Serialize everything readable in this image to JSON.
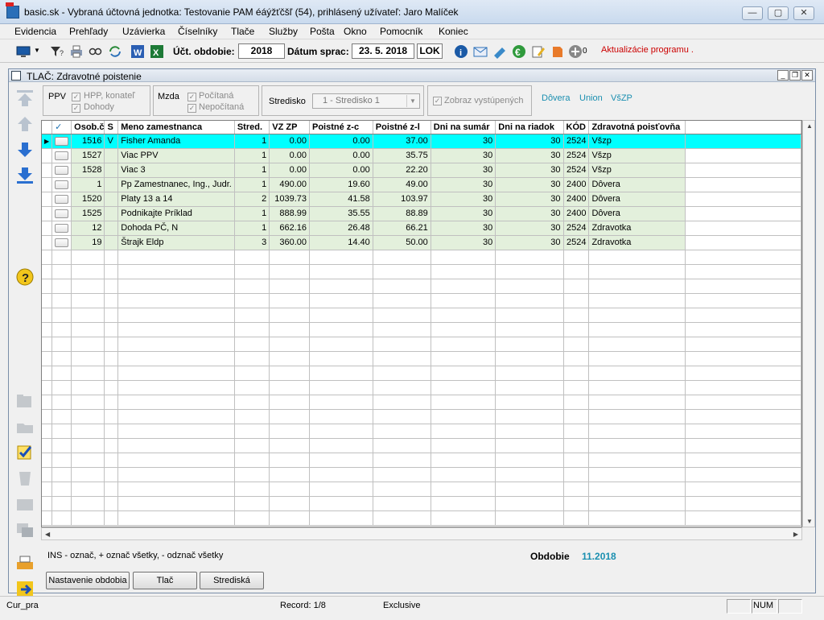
{
  "window": {
    "title": "basic.sk - Vybraná účtovná jednotka: Testovanie PAM éáýžťčšľ (54),  prihlásený užívateľ: Jaro Malíček",
    "min": "—",
    "max": "▢",
    "close": "✕"
  },
  "menu": [
    "Evidencia",
    "Prehľady",
    "Uzávierka",
    "Číselníky",
    "Tlače",
    "Služby",
    "Pošta",
    "Okno",
    "Pomocník",
    "Koniec"
  ],
  "toolbar": {
    "period_label": "Účt. obdobie:",
    "period_value": "2018",
    "date_label": "Dátum sprac:",
    "date_value": "23. 5. 2018",
    "lok": "LOK",
    "counter": "0",
    "update_link": "Aktualizácie programu  ."
  },
  "child": {
    "title": "TLAČ: Zdravotné poistenie",
    "btn_min": "_",
    "btn_restore": "❐",
    "btn_close": "✕"
  },
  "filters": {
    "ppv_label": "PPV",
    "hpp_label": "HPP, konateľ",
    "dohody_label": "Dohody",
    "mzda_label": "Mzda",
    "pocitana_label": "Počítaná",
    "nepocitana_label": "Nepočítaná",
    "stredisko_label": "Stredisko",
    "stredisko_value": "1 - Stredisko 1",
    "zobraz_label": "Zobraz vystúpených",
    "links": [
      "Dôvera",
      "Union",
      "VšZP"
    ],
    "check": "✓"
  },
  "grid": {
    "check_header": "✓",
    "columns": [
      "Osob.č",
      "S",
      "Meno zamestnanca",
      "Stred.",
      "VZ ZP",
      "Poistné z-c",
      "Poistné z-l",
      "Dni na sumár",
      "Dni na riadok",
      "KÓD",
      "Zdravotná poisťovňa"
    ],
    "rows": [
      [
        "1516",
        "V",
        "Fisher Amanda",
        "1",
        "0.00",
        "0.00",
        "37.00",
        "30",
        "30",
        "2524",
        "Všzp"
      ],
      [
        "1527",
        "",
        "Viac PPV",
        "1",
        "0.00",
        "0.00",
        "35.75",
        "30",
        "30",
        "2524",
        "Všzp"
      ],
      [
        "1528",
        "",
        "Viac 3",
        "1",
        "0.00",
        "0.00",
        "22.20",
        "30",
        "30",
        "2524",
        "Všzp"
      ],
      [
        "1",
        "",
        "Pp Zamestnanec, Ing., Judr.",
        "1",
        "490.00",
        "19.60",
        "49.00",
        "30",
        "30",
        "2400",
        "Dôvera"
      ],
      [
        "1520",
        "",
        "Platy 13 a 14",
        "2",
        "1039.73",
        "41.58",
        "103.97",
        "30",
        "30",
        "2400",
        "Dôvera"
      ],
      [
        "1525",
        "",
        "Podnikajte Príklad",
        "1",
        "888.99",
        "35.55",
        "88.89",
        "30",
        "30",
        "2400",
        "Dôvera"
      ],
      [
        "12",
        "",
        "Dohoda PČ, N",
        "1",
        "662.16",
        "26.48",
        "66.21",
        "30",
        "30",
        "2524",
        "Zdravotka"
      ],
      [
        "19",
        "",
        "Štrajk Eldp",
        "3",
        "360.00",
        "14.40",
        "50.00",
        "30",
        "30",
        "2524",
        "Zdravotka"
      ]
    ],
    "selected_marker": "▶"
  },
  "bottom": {
    "hint": "INS - označ,  + označ všetky,  - odznač všetky",
    "obdobie_label": "Obdobie",
    "obdobie_value": "11.2018",
    "buttons": [
      "Nastavenie obdobia",
      "Tlač",
      "Strediská"
    ]
  },
  "status": {
    "left": "Cur_pra",
    "record": "Record: 1/8",
    "mode": "Exclusive",
    "num": "NUM"
  }
}
